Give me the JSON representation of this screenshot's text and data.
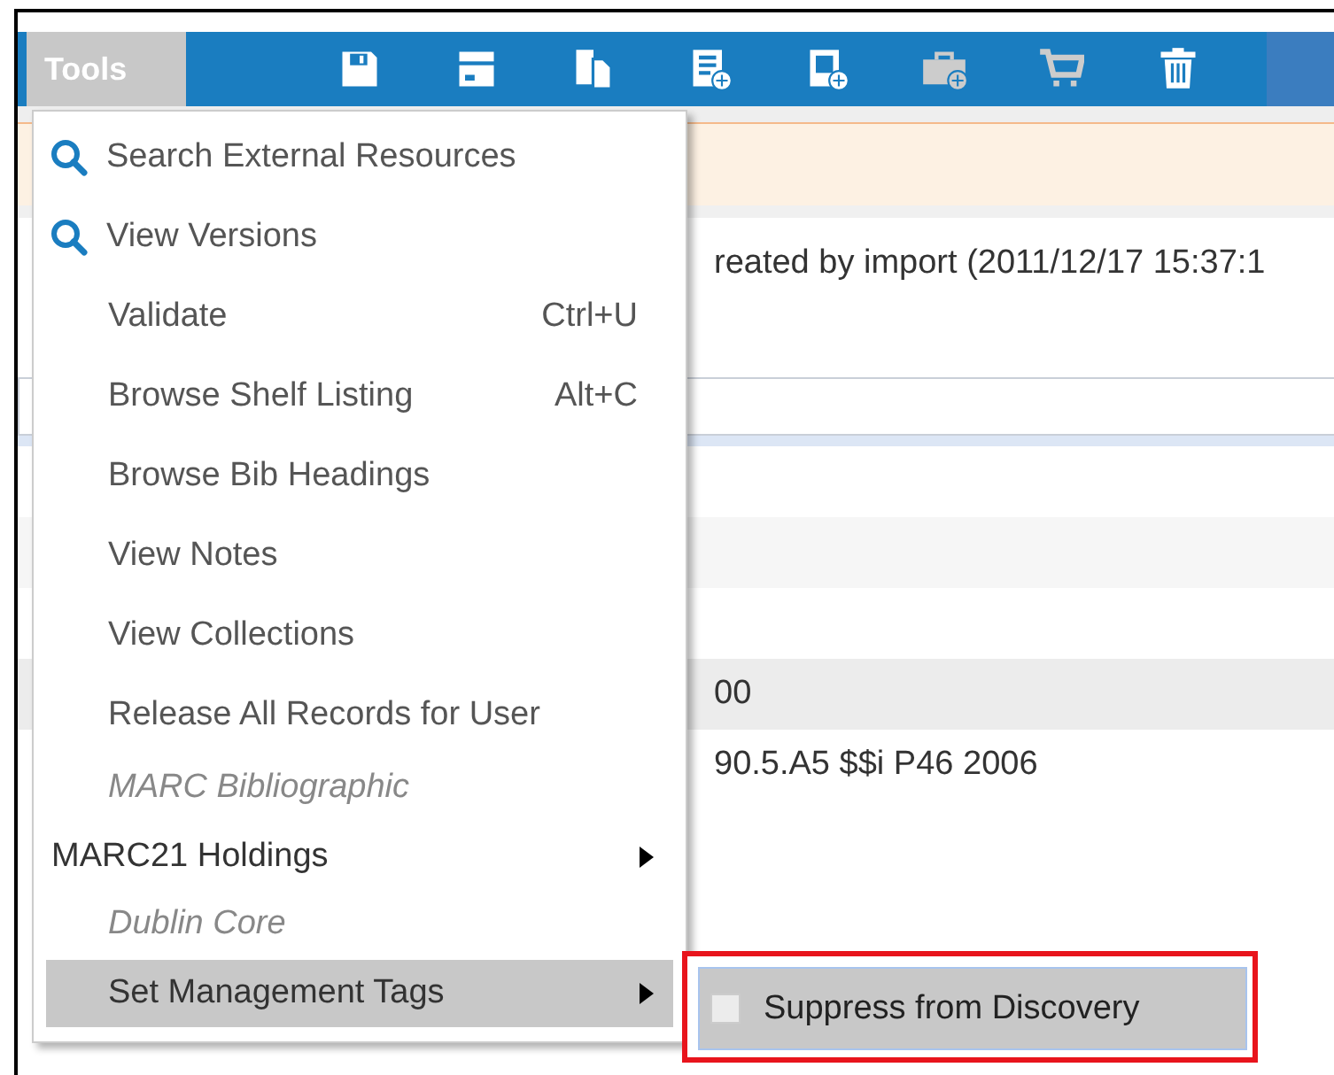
{
  "toolbar": {
    "menu_button": "Tools"
  },
  "record": {
    "created": "reated by import (2011/12/17 15:37:1",
    "lines": [
      {
        "text": "00",
        "shaded": true
      },
      {
        "text": "90.5.A5 $$i P46 2006",
        "shaded": false
      }
    ]
  },
  "menu": {
    "items": [
      {
        "kind": "search",
        "label": "Search External Resources",
        "selected": false
      },
      {
        "kind": "search",
        "label": "View Versions",
        "selected": false
      },
      {
        "kind": "action",
        "label": "Validate",
        "shortcut": "Ctrl+U",
        "selected": false
      },
      {
        "kind": "action",
        "label": "Browse Shelf Listing",
        "shortcut": "Alt+C",
        "selected": false
      },
      {
        "kind": "action",
        "label": "Browse Bib Headings",
        "selected": false
      },
      {
        "kind": "action",
        "label": "View Notes",
        "selected": false
      },
      {
        "kind": "action",
        "label": "View Collections",
        "selected": false
      },
      {
        "kind": "action",
        "label": "Release All Records for User",
        "selected": false
      },
      {
        "kind": "section",
        "label": "MARC Bibliographic"
      },
      {
        "kind": "group",
        "label": "MARC21 Holdings",
        "selected": false
      },
      {
        "kind": "section",
        "label": "Dublin Core"
      },
      {
        "kind": "submenu",
        "label": "Set Management Tags",
        "selected": true
      }
    ]
  },
  "submenu": {
    "highlighted": true,
    "items": [
      {
        "label": "Suppress from Discovery",
        "checked": false,
        "selected": true
      }
    ]
  }
}
